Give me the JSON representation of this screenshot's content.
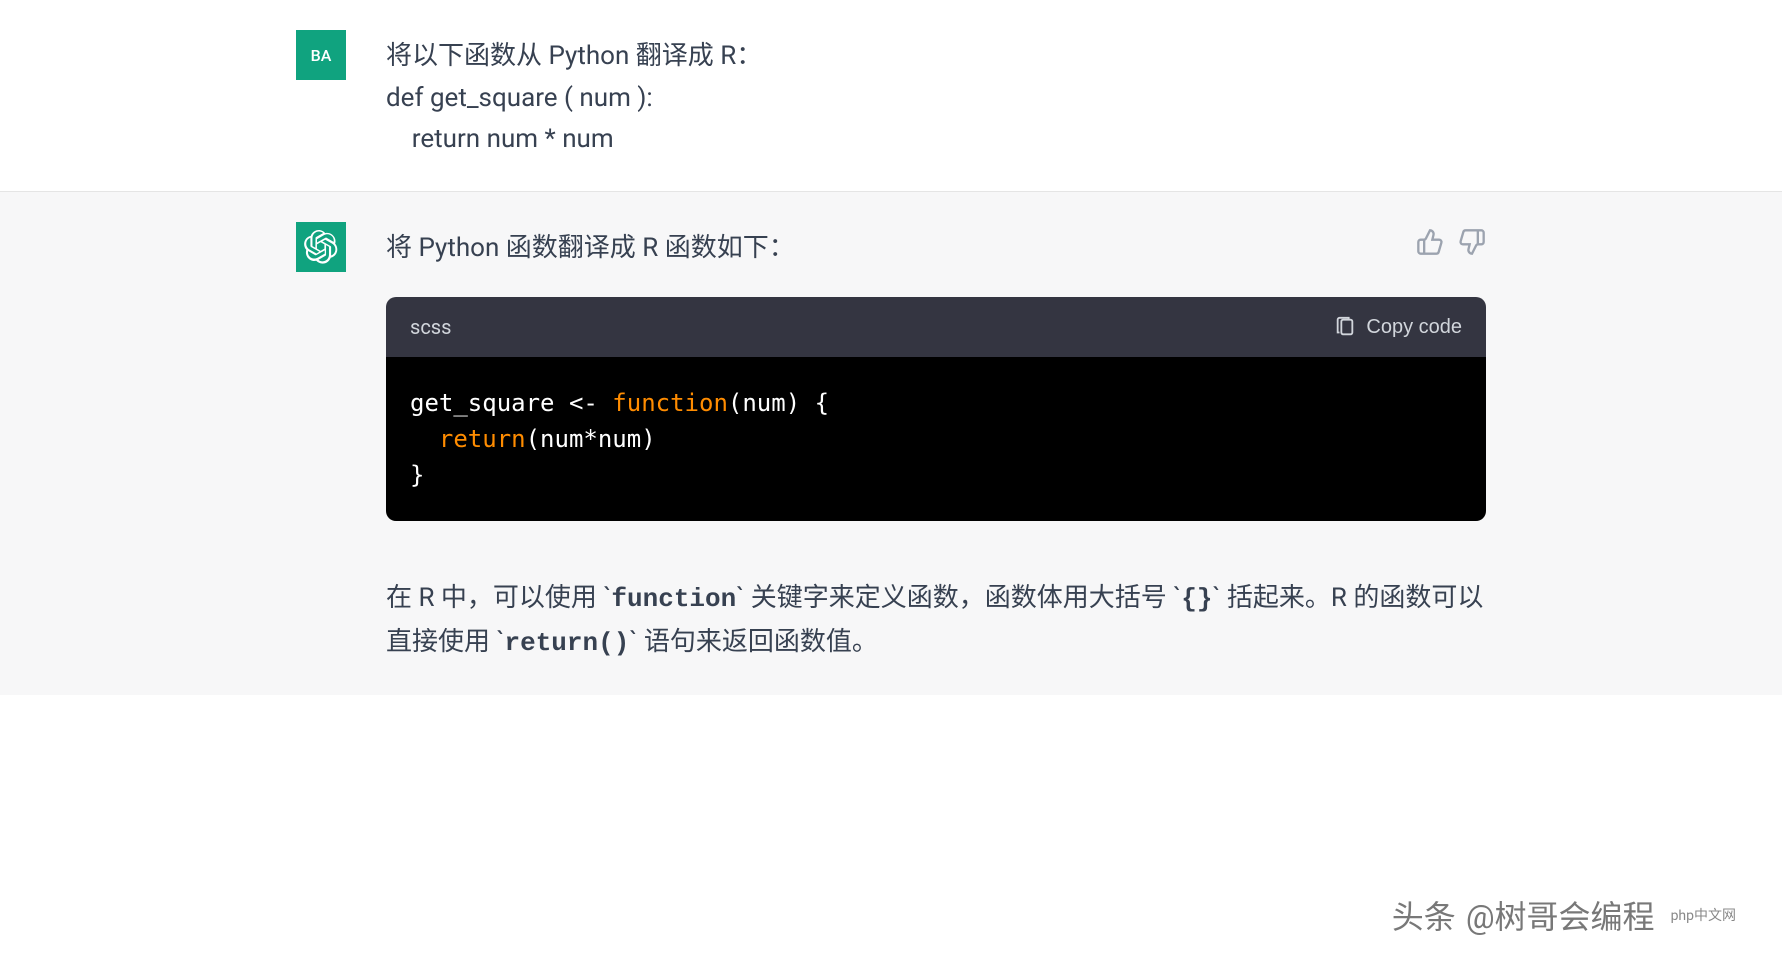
{
  "user": {
    "avatar_text": "BA",
    "line1": "将以下函数从 Python 翻译成 R：",
    "line2": "def  get_square ( num ):",
    "line3": "    return num * num"
  },
  "assistant": {
    "intro": "将 Python 函数翻译成 R 函数如下：",
    "code": {
      "language_label": "scss",
      "copy_label": "Copy code",
      "line1_a": "get_square <- ",
      "line1_b": "function",
      "line1_c": "(num) {",
      "line2_a": "  ",
      "line2_b": "return",
      "line2_c": "(num*num)",
      "line3": "}"
    },
    "explanation_parts": {
      "p1": "在 R 中，可以使用 `",
      "c1": "function",
      "p2": "` 关键字来定义函数，函数体用大括号 `",
      "c2": "{}",
      "p3": "` 括起来。R 的函数可以直接使用 `",
      "c3": "return()",
      "p4": "` 语句来返回函数值。"
    }
  },
  "watermark": {
    "prefix": "头条",
    "author": "@树哥会编程",
    "badge": "php中文网"
  }
}
